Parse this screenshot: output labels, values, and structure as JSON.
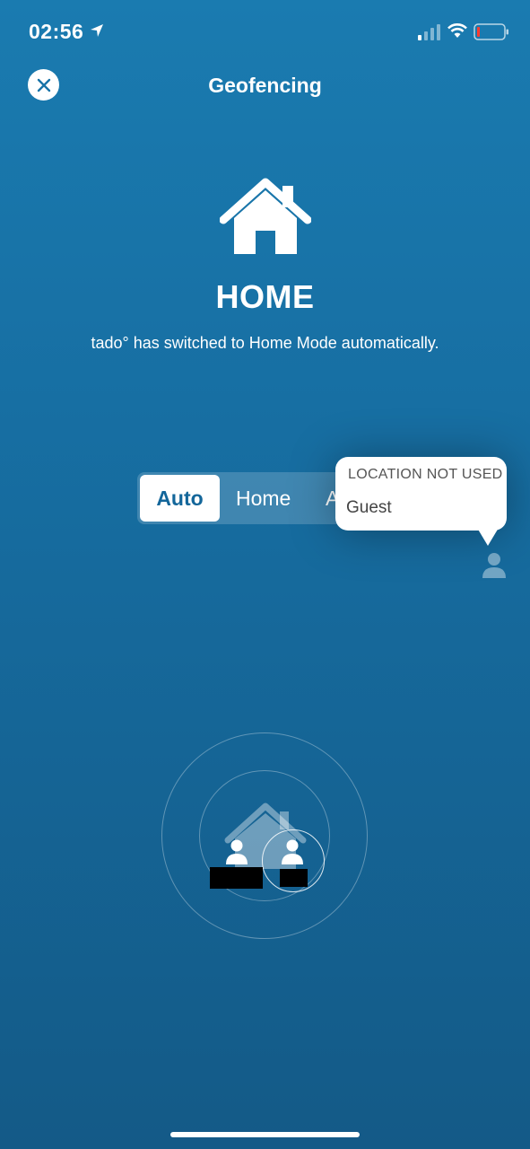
{
  "status_bar": {
    "time": "02:56",
    "icons": [
      "location-arrow-icon",
      "cellular-signal-icon",
      "wifi-icon",
      "battery-low-icon"
    ]
  },
  "header": {
    "close_icon": "close-icon",
    "title": "Geofencing"
  },
  "mode": {
    "icon": "home-icon",
    "title": "HOME",
    "description": "tado° has switched to Home Mode automatically."
  },
  "mode_selector": {
    "options": [
      "Auto",
      "Home",
      "Away"
    ],
    "selected": "Auto",
    "visible_options": [
      "Auto",
      "Home",
      "A"
    ]
  },
  "tooltip": {
    "title": "LOCATION NOT USED",
    "body": "Guest"
  },
  "map": {
    "icons": [
      "house-icon",
      "user-icon",
      "user-icon"
    ]
  },
  "colors": {
    "background_top": "#1a7bb0",
    "background_bottom": "#145a87",
    "accent": "#13669a",
    "white": "#ffffff"
  }
}
